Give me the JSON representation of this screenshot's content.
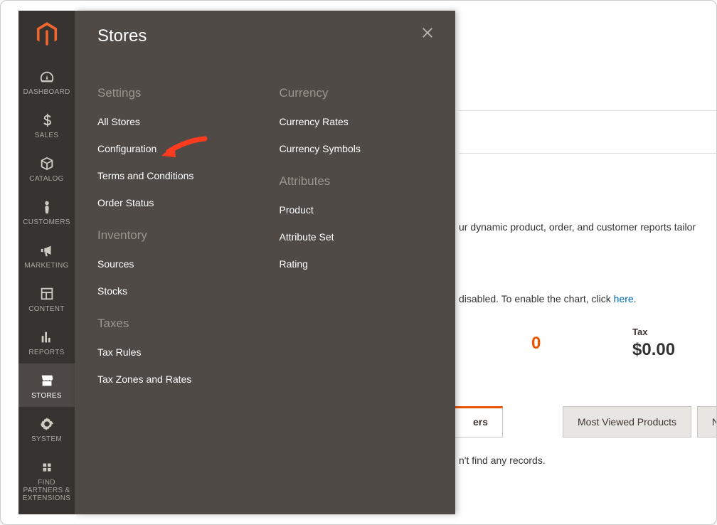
{
  "nav": [
    {
      "label": "DASHBOARD"
    },
    {
      "label": "SALES"
    },
    {
      "label": "CATALOG"
    },
    {
      "label": "CUSTOMERS"
    },
    {
      "label": "MARKETING"
    },
    {
      "label": "CONTENT"
    },
    {
      "label": "REPORTS"
    },
    {
      "label": "STORES"
    },
    {
      "label": "SYSTEM"
    },
    {
      "label": "FIND PARTNERS & EXTENSIONS"
    }
  ],
  "flyout": {
    "title": "Stores",
    "sections": {
      "settings_title": "Settings",
      "settings": [
        "All Stores",
        "Configuration",
        "Terms and Conditions",
        "Order Status"
      ],
      "inventory_title": "Inventory",
      "inventory": [
        "Sources",
        "Stocks"
      ],
      "taxes_title": "Taxes",
      "taxes": [
        "Tax Rules",
        "Tax Zones and Rates"
      ],
      "currency_title": "Currency",
      "currency": [
        "Currency Rates",
        "Currency Symbols"
      ],
      "attributes_title": "Attributes",
      "attributes": [
        "Product",
        "Attribute Set",
        "Rating"
      ]
    }
  },
  "main": {
    "promo_fragment": "ur dynamic product, order, and customer reports tailor",
    "chart_note_prefix": "disabled. To enable the chart, click ",
    "chart_note_link": "here",
    "chart_note_suffix": ".",
    "tax_label": "Tax",
    "tax_amount": "$0.00",
    "orange_fragment": "0",
    "tabs": {
      "active_fragment": "ers",
      "most_viewed": "Most Viewed Products",
      "new_customers_fragment": "New Customer"
    },
    "no_records_fragment": "n't find any records."
  }
}
